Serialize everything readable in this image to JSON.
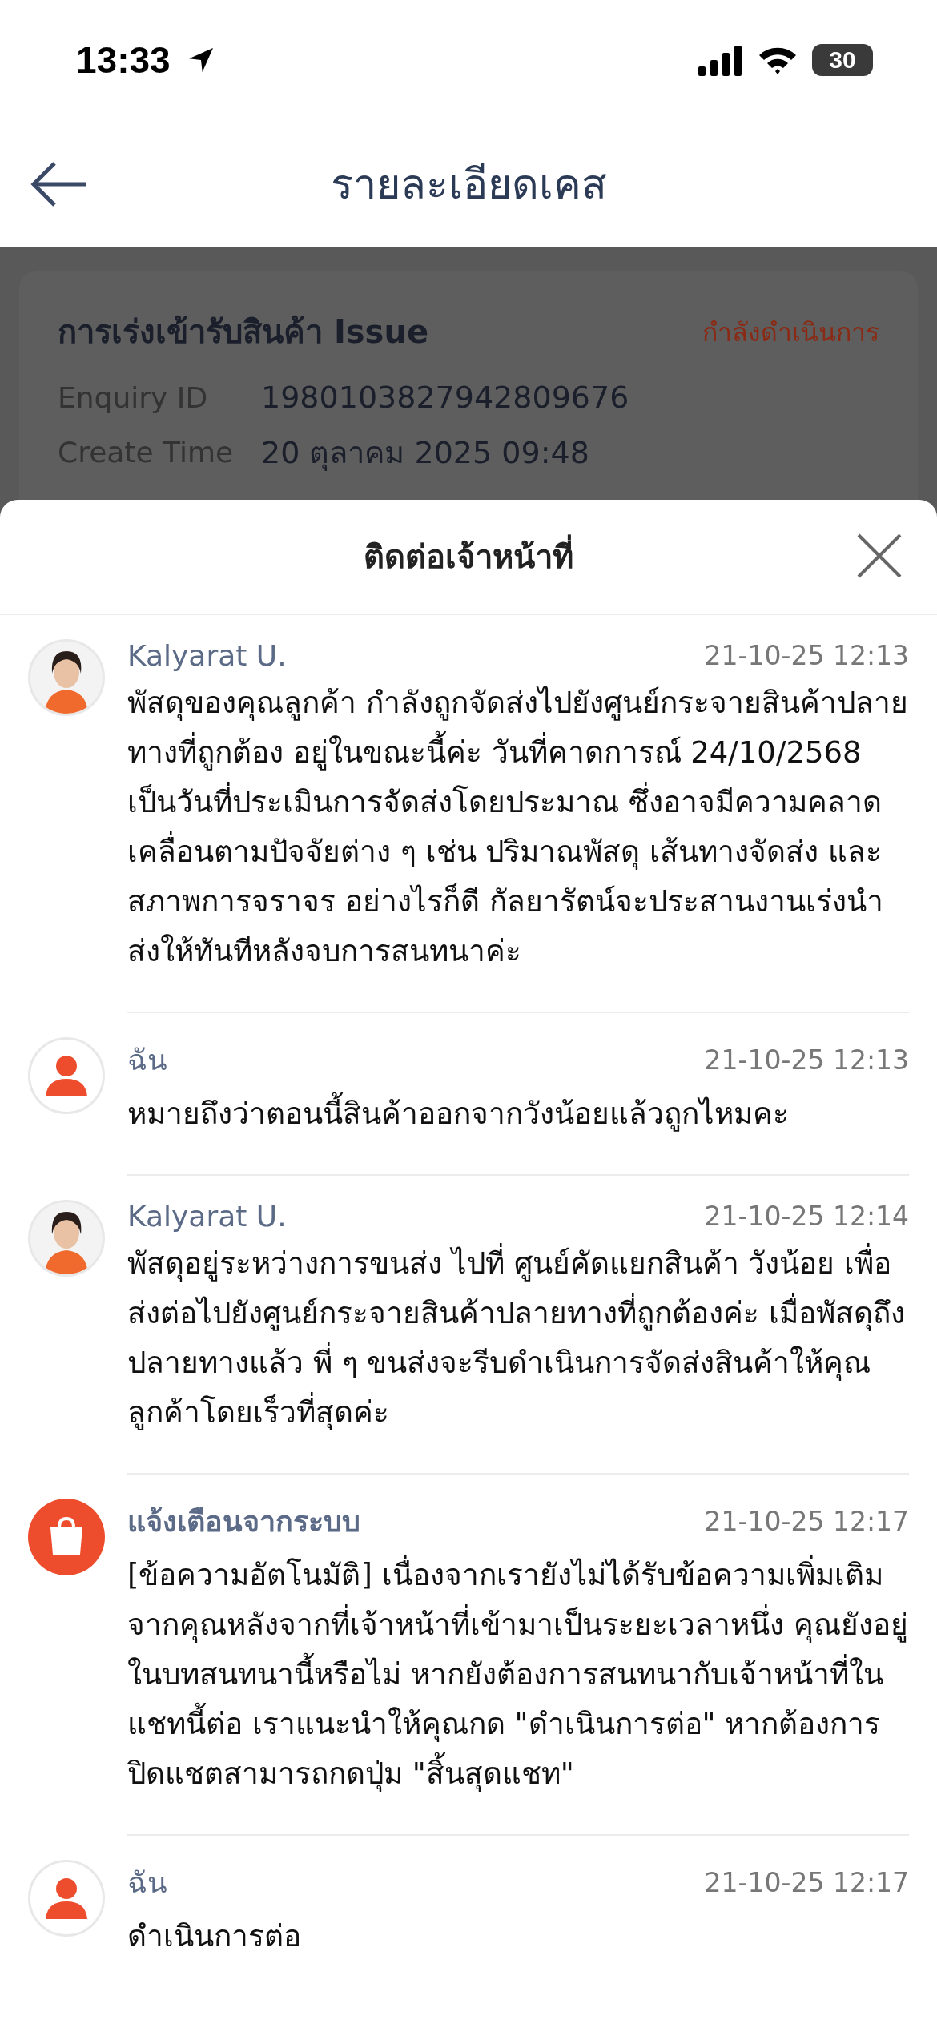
{
  "status_bar": {
    "time": "13:33",
    "battery": "30"
  },
  "header": {
    "title": "รายละเอียดเคส"
  },
  "case_card": {
    "title": "การเร่งเข้ารับสินค้า Issue",
    "status": "กำลังดำเนินการ",
    "fields": [
      {
        "label": "Enquiry ID",
        "value": "1980103827942809676"
      },
      {
        "label": "Create Time",
        "value": "20 ตุลาคม 2025 09:48"
      }
    ]
  },
  "sheet": {
    "title": "ติดต่อเจ้าหน้าที่",
    "messages": [
      {
        "kind": "agent",
        "sender": "Kalyarat U.",
        "time": "21-10-25 12:13",
        "text": "พัสดุของคุณลูกค้า กำลังถูกจัดส่งไปยังศูนย์กระจายสินค้าปลายทางที่ถูกต้อง อยู่ในขณะนี้ค่ะ วันที่คาดการณ์ 24/10/2568 เป็นวันที่ประเมินการจัดส่งโดยประมาณ ซึ่งอาจมีความคลาดเคลื่อนตามปัจจัยต่าง ๆ เช่น ปริมาณพัสดุ เส้นทางจัดส่ง และสภาพการจราจร อย่างไรก็ดี กัลยารัตน์จะประสานงานเร่งนำส่งให้ทันทีหลังจบการสนทนาค่ะ"
      },
      {
        "kind": "user",
        "sender": "ฉัน",
        "time": "21-10-25 12:13",
        "text": "หมายถึงว่าตอนนี้สินค้าออกจากวังน้อยแล้วถูกไหมคะ"
      },
      {
        "kind": "agent",
        "sender": "Kalyarat U.",
        "time": "21-10-25 12:14",
        "text": "พัสดุอยู่ระหว่างการขนส่ง ไปที่ ศูนย์คัดแยกสินค้า วังน้อย เพื่อส่งต่อไปยังศูนย์กระจายสินค้าปลายทางที่ถูกต้องค่ะ เมื่อพัสดุถึงปลายทางแล้ว พี่ ๆ ขนส่งจะรีบดำเนินการจัดส่งสินค้าให้คุณลูกค้าโดยเร็วที่สุดค่ะ"
      },
      {
        "kind": "system",
        "sender": "แจ้งเตือนจากระบบ",
        "time": "21-10-25 12:17",
        "text": "[ข้อความอัตโนมัติ] เนื่องจากเรายังไม่ได้รับข้อความเพิ่มเติมจากคุณหลังจากที่เจ้าหน้าที่เข้ามาเป็นระยะเวลาหนึ่ง คุณยังอยู่ในบทสนทนานี้หรือไม่ หากยังต้องการสนทนากับเจ้าหน้าที่ในแชทนี้ต่อ เราแนะนำให้คุณกด \"ดำเนินการต่อ\" หากต้องการปิดแชตสามารถกดปุ่ม \"สิ้นสุดแชท\""
      },
      {
        "kind": "user",
        "sender": "ฉัน",
        "time": "21-10-25 12:17",
        "text": "ดำเนินการต่อ"
      }
    ]
  }
}
